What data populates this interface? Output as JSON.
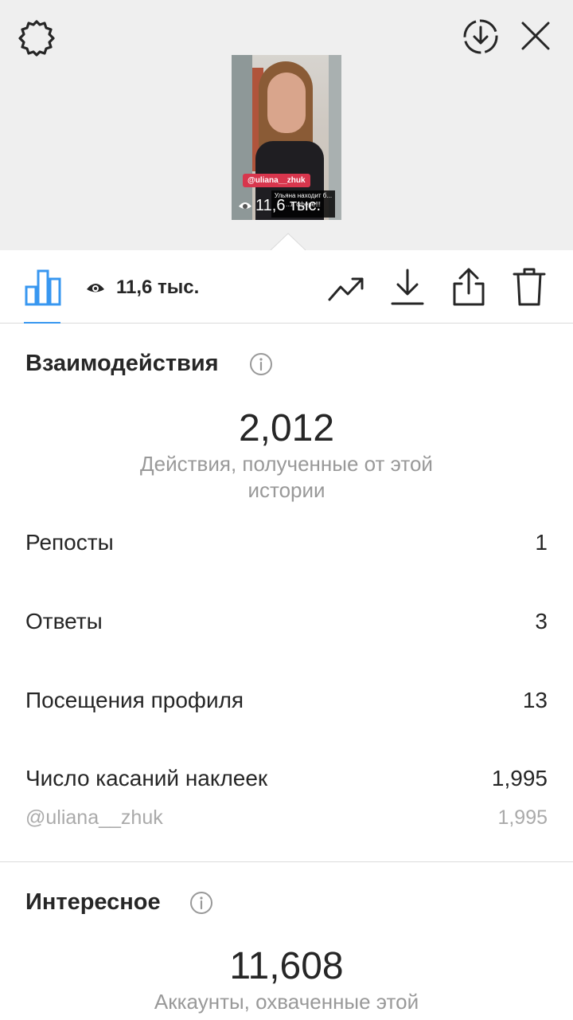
{
  "top": {
    "settings_icon": "settings-gear-icon",
    "download_icon": "download-circle-icon",
    "close_icon": "close-icon"
  },
  "story_thumbnail": {
    "tag": "@uliana__zhuk",
    "caption": "Ульяна находит б... ...в сфере!!!",
    "views": "11,6 тыс."
  },
  "toolbar": {
    "views_count": "11,6 тыс.",
    "icons": [
      "bar-chart-icon",
      "eye-icon",
      "trend-up-icon",
      "download-icon",
      "share-icon",
      "trash-icon"
    ],
    "accent_color": "#3897f0"
  },
  "interactions": {
    "title": "Взаимодействия",
    "total": "2,012",
    "total_caption": "Действия, полученные от этой истории",
    "rows": [
      {
        "label": "Репосты",
        "value": "1"
      },
      {
        "label": "Ответы",
        "value": "3"
      },
      {
        "label": "Посещения профиля",
        "value": "13"
      },
      {
        "label": "Число касаний наклеек",
        "value": "1,995"
      }
    ],
    "sub_row": {
      "label": "@uliana__zhuk",
      "value": "1,995"
    }
  },
  "discovery": {
    "title": "Интересное",
    "total": "11,608",
    "total_caption": "Аккаунты, охваченные этой"
  }
}
